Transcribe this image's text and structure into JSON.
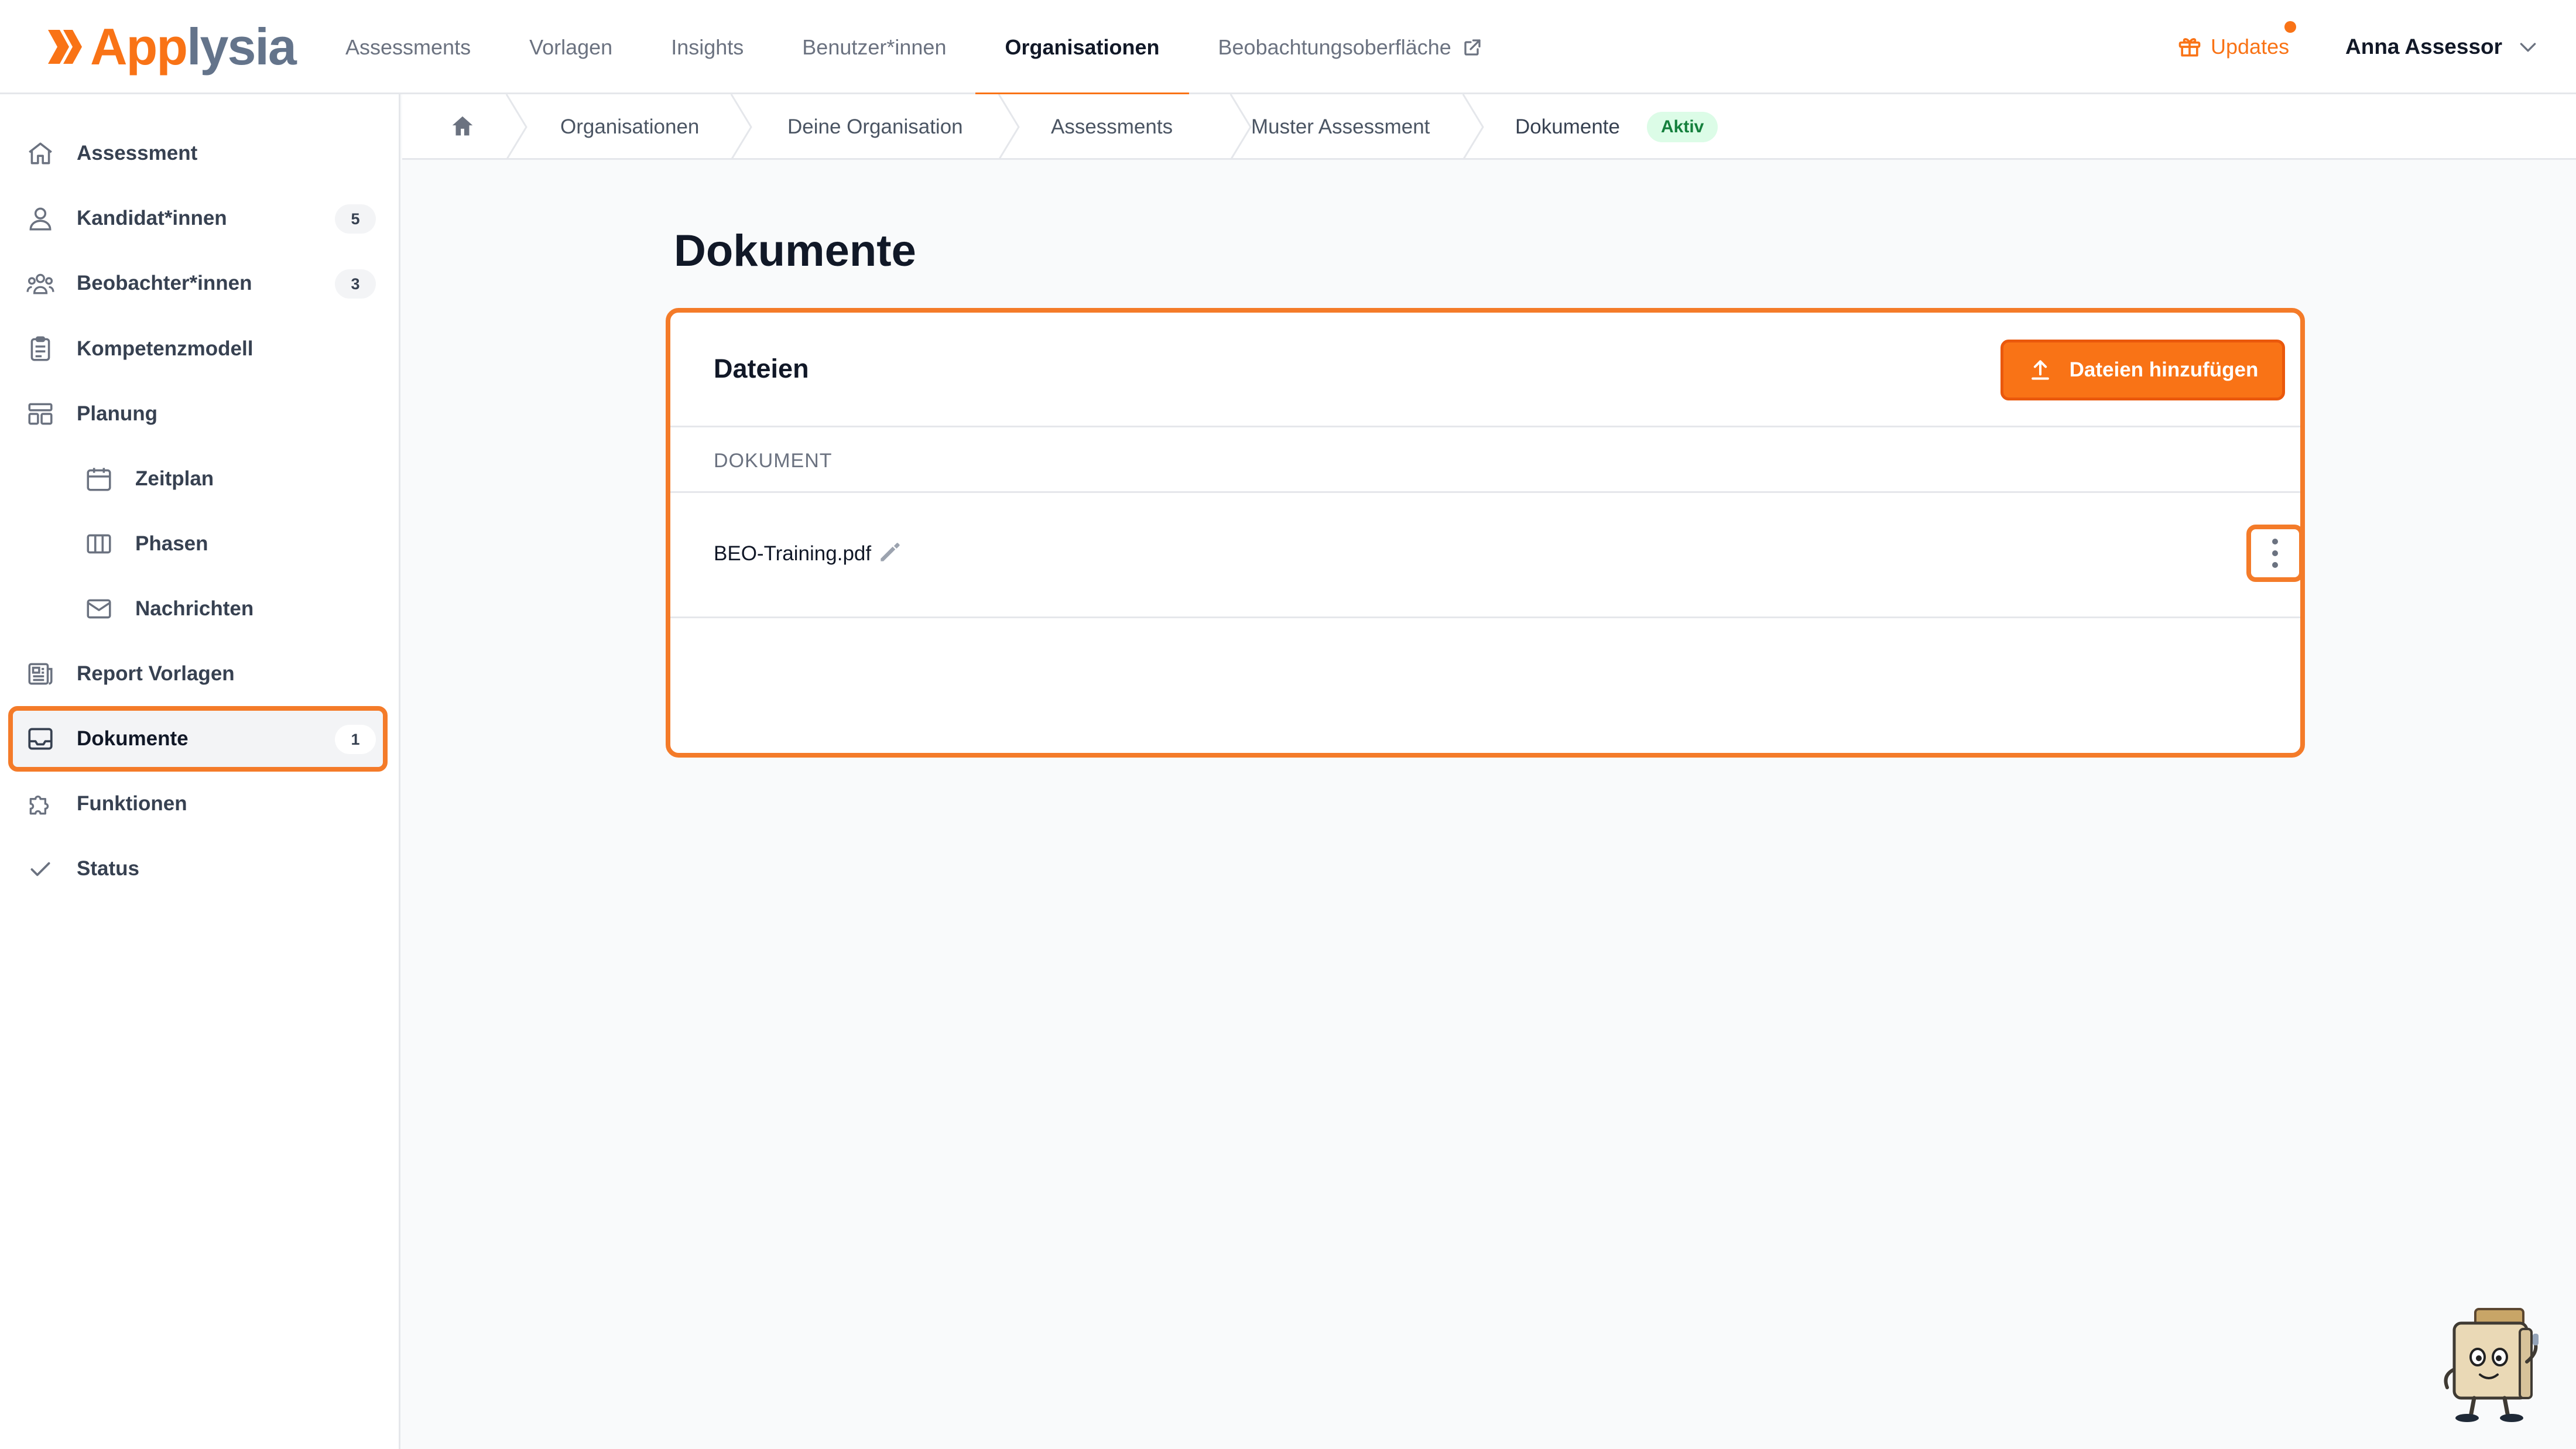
{
  "app": {
    "logo_text_a": "App",
    "logo_text_b": "lysia",
    "brand_color": "#f97316"
  },
  "topnav": {
    "items": [
      {
        "label": "Assessments",
        "active": false
      },
      {
        "label": "Vorlagen",
        "active": false
      },
      {
        "label": "Insights",
        "active": false
      },
      {
        "label": "Benutzer*innen",
        "active": false
      },
      {
        "label": "Organisationen",
        "active": true
      },
      {
        "label": "Beobachtungsoberfläche",
        "active": false,
        "icon": "external-link-icon"
      }
    ],
    "updates_label": "Updates",
    "user_name": "Anna Assessor"
  },
  "sidebar": {
    "items": [
      {
        "label": "Assessment",
        "icon": "home-icon"
      },
      {
        "label": "Kandidat*innen",
        "icon": "user-icon",
        "badge": "5"
      },
      {
        "label": "Beobachter*innen",
        "icon": "users-icon",
        "badge": "3"
      },
      {
        "label": "Kompetenzmodell",
        "icon": "clipboard-icon"
      },
      {
        "label": "Planung",
        "icon": "layout-icon"
      },
      {
        "label": "Zeitplan",
        "icon": "calendar-icon",
        "sub": true
      },
      {
        "label": "Phasen",
        "icon": "columns-icon",
        "sub": true
      },
      {
        "label": "Nachrichten",
        "icon": "envelope-icon",
        "sub": true
      },
      {
        "label": "Report Vorlagen",
        "icon": "newspaper-icon"
      },
      {
        "label": "Dokumente",
        "icon": "inbox-icon",
        "badge": "1",
        "active": true
      },
      {
        "label": "Funktionen",
        "icon": "puzzle-icon"
      },
      {
        "label": "Status",
        "icon": "check-icon"
      }
    ]
  },
  "breadcrumb": {
    "items": [
      "Organisationen",
      "Deine Organisation",
      "Assessments",
      "Muster Assessment",
      "Dokumente"
    ],
    "status": "Aktiv"
  },
  "main": {
    "title": "Dokumente",
    "card_title": "Dateien",
    "add_button": "Dateien hinzufügen",
    "column_header": "DOKUMENT",
    "documents": [
      {
        "name": "BEO-Training.pdf"
      }
    ]
  },
  "colors": {
    "accent": "#f97316",
    "highlight": "#f47b29",
    "status_bg": "#dcfce7",
    "status_fg": "#15803d"
  }
}
